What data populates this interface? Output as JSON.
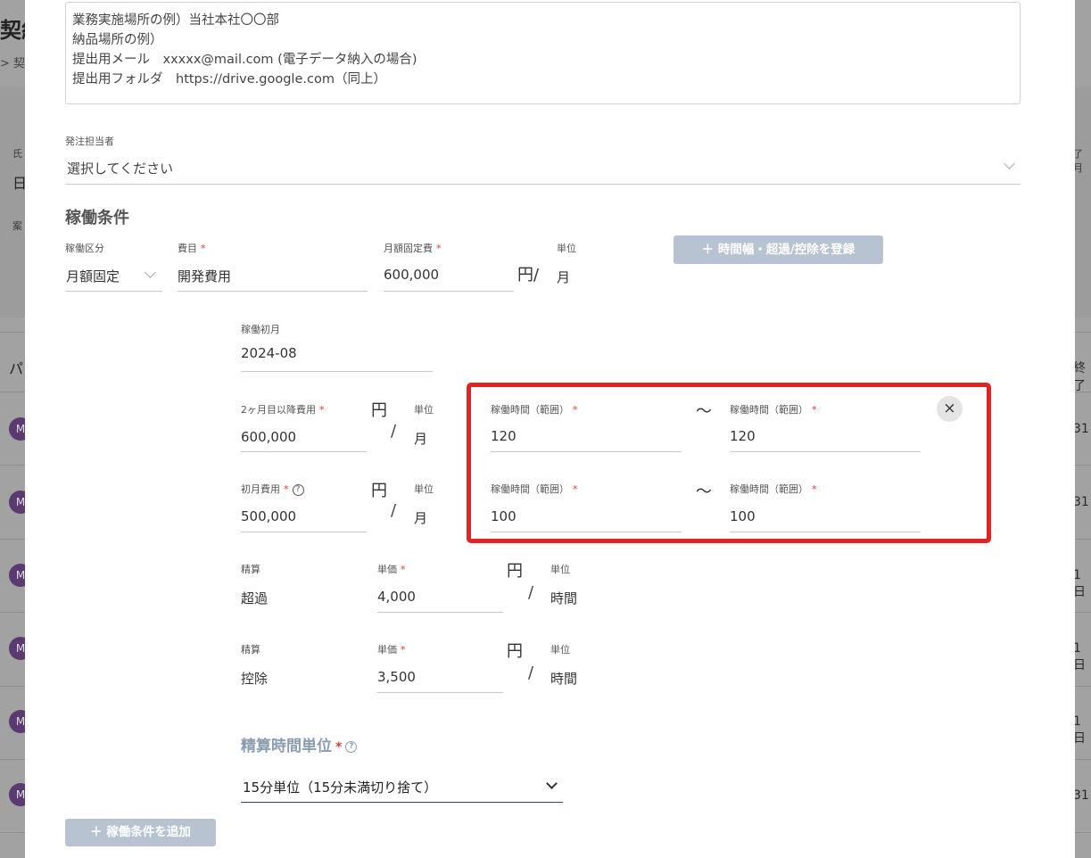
{
  "background": {
    "title_fragment": "契約",
    "crumb_fragment": "> 契",
    "left_small_1": "氏",
    "left_big_1": "日",
    "left_small_2": "案",
    "list_header": "パ",
    "avatar_initial": "M",
    "right_header_1": "了月",
    "right_header_2": "終了",
    "right_cells": [
      "31",
      "31",
      "1日",
      "1日",
      "1日",
      "31"
    ]
  },
  "textarea": {
    "lines": [
      "業務実施場所の例）当社本社〇〇部",
      "納品場所の例）",
      "提出用メール　xxxxx@mail.com (電子データ納入の場合)",
      "提出用フォルダ　https://drive.google.com（同上）"
    ]
  },
  "orderer": {
    "label": "発注担当者",
    "placeholder": "選択してください"
  },
  "work_conditions": {
    "title": "稼働条件",
    "type_label": "稼働区分",
    "type_value": "月額固定",
    "expense_label": "費目",
    "expense_value": "開発費用",
    "monthly_fixed_label": "月額固定費",
    "monthly_fixed_value": "600,000",
    "yen_slash": "円/",
    "unit_label": "単位",
    "unit_value": "月",
    "register_button": "＋ 時間幅・超過/控除を登録",
    "first_month_label": "稼働初月",
    "first_month_value": "2024-08",
    "second_month_label": "2ヶ月目以降費用",
    "second_month_value": "600,000",
    "first_month_fee_label": "初月費用",
    "first_month_fee_value": "500,000",
    "yen": "円",
    "slash": "/",
    "month": "月",
    "range_label": "稼働時間（範囲）",
    "tilde": "〜",
    "range_row1_from": "120",
    "range_row1_to": "120",
    "range_row2_from": "100",
    "range_row2_to": "100",
    "close_symbol": "×",
    "settlement_label": "精算",
    "unit_price_label": "単価",
    "overtime_type": "超過",
    "overtime_price": "4,000",
    "deduction_type": "控除",
    "deduction_price": "3,500",
    "hour": "時間",
    "settlement_unit_title": "精算時間単位",
    "settlement_unit_value": "15分単位（15分未満切り捨て）",
    "add_button": "＋ 稼働条件を追加"
  },
  "colors": {
    "required": "#e53935",
    "highlight": "#e02424",
    "button_disabled": "#b8c3d1"
  }
}
